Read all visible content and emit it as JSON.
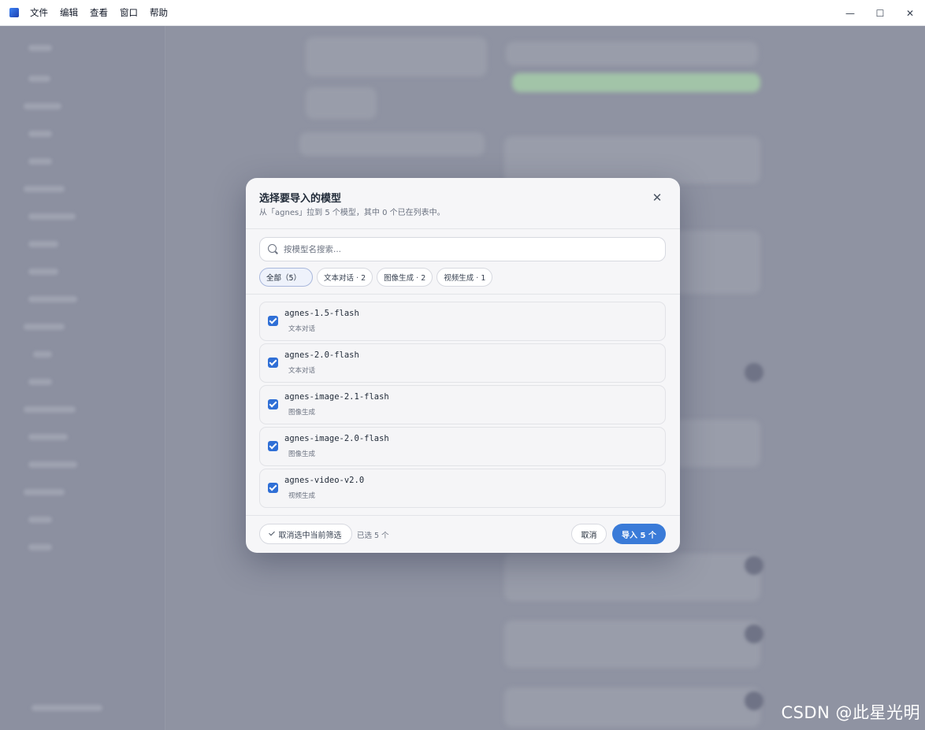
{
  "menubar": {
    "items": [
      "文件",
      "编辑",
      "查看",
      "窗口",
      "帮助"
    ],
    "window_controls": {
      "minimize": "—",
      "maximize": "☐",
      "close": "✕"
    }
  },
  "dialog": {
    "title": "选择要导入的模型",
    "subtitle": "从「agnes」拉到 5 个模型，其中 0 个已在列表中。",
    "close_icon": "✕",
    "search": {
      "placeholder": "按模型名搜索...",
      "value": ""
    },
    "filters": [
      {
        "label": "全部（5）",
        "active": true
      },
      {
        "label": "文本对话 · 2",
        "active": false
      },
      {
        "label": "图像生成 · 2",
        "active": false
      },
      {
        "label": "视频生成 · 1",
        "active": false
      }
    ],
    "models": [
      {
        "name": "agnes-1.5-flash",
        "type": "文本对话",
        "checked": true
      },
      {
        "name": "agnes-2.0-flash",
        "type": "文本对话",
        "checked": true
      },
      {
        "name": "agnes-image-2.1-flash",
        "type": "图像生成",
        "checked": true
      },
      {
        "name": "agnes-image-2.0-flash",
        "type": "图像生成",
        "checked": true
      },
      {
        "name": "agnes-video-v2.0",
        "type": "视频生成",
        "checked": true
      }
    ],
    "footer": {
      "clear_label": "取消选中当前筛选",
      "selected_text": "已选 5 个",
      "cancel_label": "取消",
      "import_label": "导入 5 个"
    }
  },
  "watermark": "CSDN @此星光明",
  "colors": {
    "accent": "#3a7bd8",
    "checkbox": "#2f6fd6",
    "overlay": "#8f93a2"
  }
}
